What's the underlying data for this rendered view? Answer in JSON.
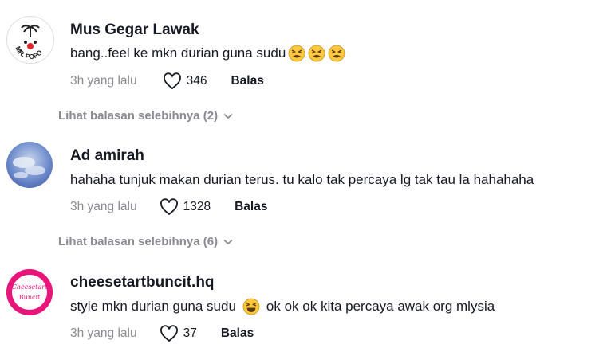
{
  "comments": [
    {
      "author": "Mus Gegar Lawak",
      "text": "bang..feel ke mkn durian guna sudu",
      "text_after": "",
      "emojis_inline": [
        "tired-face-emoji",
        "tired-face-emoji",
        "tired-face-emoji"
      ],
      "time": "3h yang lalu",
      "likes": "346",
      "reply_label": "Balas",
      "avatar_text": "MR. POPO"
    },
    {
      "author": "Ad amirah",
      "text": "hahaha tunjuk makan durian terus. tu kalo tak percaya lg tak tau la hahahaha",
      "time": "3h yang lalu",
      "likes": "1328",
      "reply_label": "Balas"
    },
    {
      "author": "cheesetartbuncit.hq",
      "text": "style mkn durian guna sudu",
      "text_after": "ok ok ok kita percaya awak org mlysia",
      "emoji": "laughing-squint-emoji",
      "time": "3h yang lalu",
      "likes": "37",
      "reply_label": "Balas",
      "avatar_text_top": "Cheesetart",
      "avatar_text_bottom": "Buncit"
    }
  ],
  "view_more": [
    "Lihat balasan selebihnya (2)",
    "Lihat balasan selebihnya (6)"
  ],
  "colors": {
    "meta_gray": "#8a8b91",
    "text": "#161823",
    "cheesetart_pink": "#e8157a",
    "emoji_yellow": "#ffc83d"
  }
}
